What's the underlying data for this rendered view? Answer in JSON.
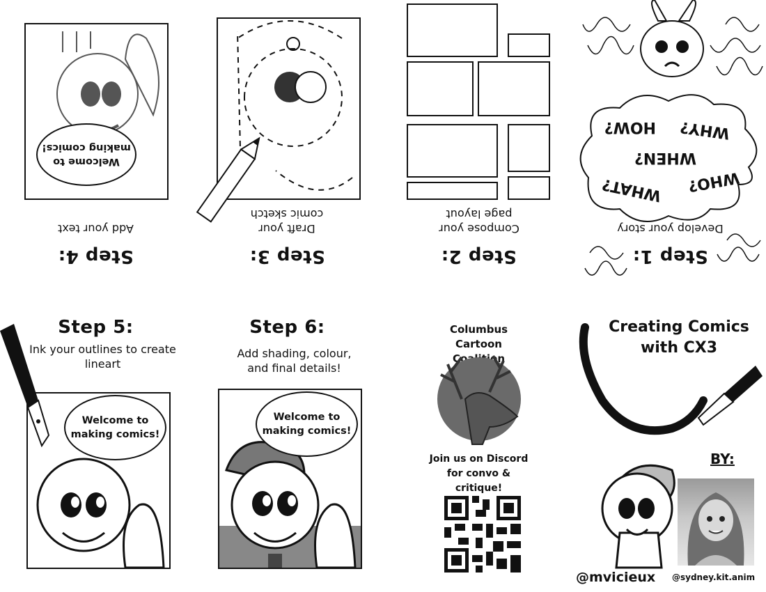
{
  "cover": {
    "title": "Creating Comics with CX3",
    "by_label": "BY:",
    "handle_main": "@mvicieux",
    "handle_secondary": "@sydney.kit.anim"
  },
  "club": {
    "name": "Columbus Cartoon Coalition",
    "discord_text": "Join us on Discord for convo & critique!"
  },
  "steps": [
    {
      "title": "Step 1:",
      "description": "Develop your story"
    },
    {
      "title": "Step 2:",
      "description": "Compose your page layout"
    },
    {
      "title": "Step 3:",
      "description": "Draft your comic sketch"
    },
    {
      "title": "Step 4:",
      "description": "Add your text"
    },
    {
      "title": "Step 5:",
      "description": "Ink your outlines to create lineart"
    },
    {
      "title": "Step 6:",
      "description": "Add shading, colour, and final details!"
    }
  ],
  "speech_bubble_text": "Welcome to making comics!",
  "thought_words": [
    "WHO?",
    "WHAT?",
    "WHEN?",
    "WHY?",
    "HOW?"
  ]
}
